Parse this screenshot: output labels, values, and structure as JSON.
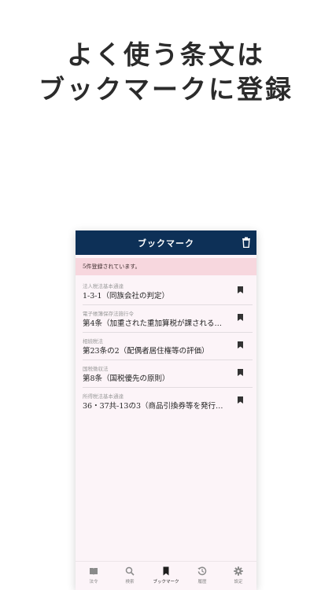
{
  "headline": {
    "line1": "よく使う条文は",
    "line2": "ブックマークに登録"
  },
  "appbar": {
    "title": "ブックマーク",
    "trash_icon": "trash-icon"
  },
  "notice": "5件登録されています。",
  "bookmarks": [
    {
      "category": "法人税法基本通達",
      "title": "1-3-1（同族会社の判定）"
    },
    {
      "category": "電子帳簿保存法施行令",
      "title": "第4条（加重された重加算税が課される…"
    },
    {
      "category": "相続税法",
      "title": "第23条の2（配偶者居住権等の評価）"
    },
    {
      "category": "国税徴収法",
      "title": "第8条（国税優先の原則）"
    },
    {
      "category": "所得税法基本通達",
      "title": "36・37共-13の3（商品引換券等を発行…"
    }
  ],
  "tabs": [
    {
      "label": "法令",
      "icon": "book-icon"
    },
    {
      "label": "検索",
      "icon": "search-icon"
    },
    {
      "label": "ブックマーク",
      "icon": "bookmark-icon",
      "active": true
    },
    {
      "label": "履歴",
      "icon": "history-icon"
    },
    {
      "label": "設定",
      "icon": "gear-icon"
    }
  ],
  "colors": {
    "appbar": "#0d3057",
    "notice_bg": "#f7d7de",
    "screen_bg": "#fcf4f8"
  }
}
